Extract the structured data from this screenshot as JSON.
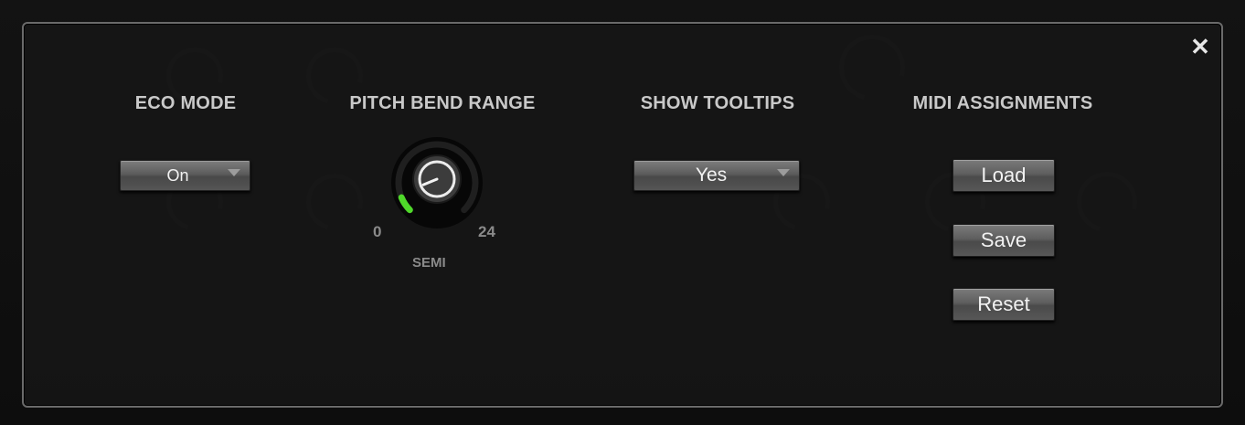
{
  "dialog": {
    "close_label": "✕",
    "close_icon": "close-icon"
  },
  "eco_mode": {
    "heading": "ECO MODE",
    "selected": "On"
  },
  "pitch_bend": {
    "heading": "PITCH BEND RANGE",
    "min_label": "0",
    "max_label": "24",
    "unit_label": "SEMI",
    "knob_value": 2,
    "range_min": 0,
    "range_max": 24,
    "accent_color": "#4fd82a"
  },
  "tooltips": {
    "heading": "SHOW TOOLTIPS",
    "selected": "Yes"
  },
  "midi": {
    "heading": "MIDI ASSIGNMENTS",
    "load_label": "Load",
    "save_label": "Save",
    "reset_label": "Reset"
  }
}
